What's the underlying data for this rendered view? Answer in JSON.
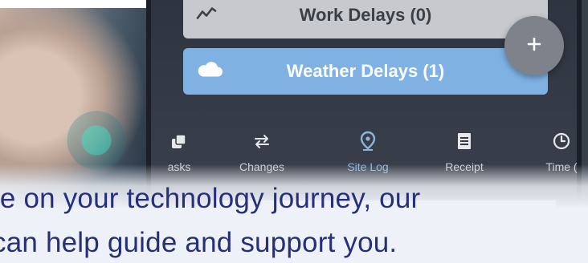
{
  "app": {
    "rows": [
      {
        "id": "work",
        "label": "Work Delays (0)",
        "icon": "trend-line-icon"
      },
      {
        "id": "weather",
        "label": "Weather Delays (1)",
        "icon": "cloud-icon"
      }
    ],
    "fab_icon": "plus-icon",
    "nav": [
      {
        "label": "asks",
        "icon": "tasks-icon",
        "active": false
      },
      {
        "label": "Changes",
        "icon": "swap-arrows-icon",
        "active": false
      },
      {
        "label": "Site Log",
        "icon": "location-pin-icon",
        "active": true
      },
      {
        "label": "Receipt",
        "icon": "receipt-icon",
        "active": false
      },
      {
        "label": "Time (",
        "icon": "clock-icon",
        "active": false
      }
    ]
  },
  "caption": {
    "line1": "re on your technology journey, our",
    "line2": "can help guide and support you."
  },
  "colors": {
    "work_row": "#c7c9ce",
    "weather_row": "#7fb2e3",
    "caption_text": "#26307a",
    "active_nav": "#8fb3d8"
  }
}
